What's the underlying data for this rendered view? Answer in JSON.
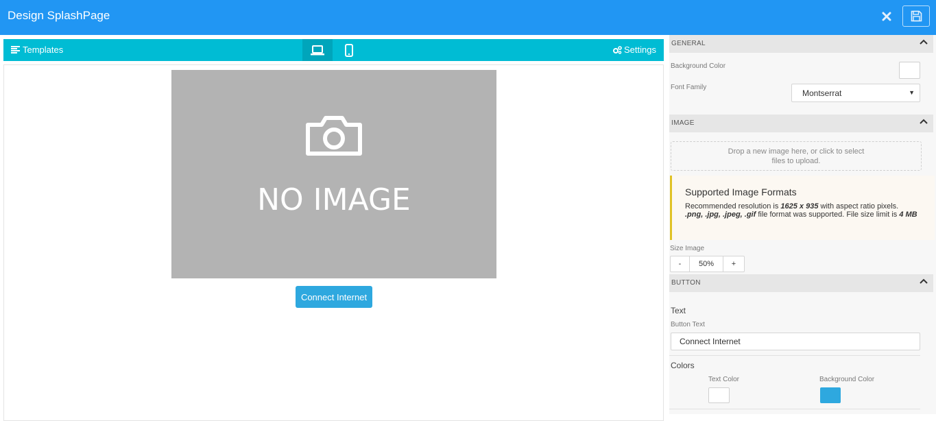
{
  "app": {
    "title": "Design SplashPage"
  },
  "toolbar": {
    "templates_label": "Templates",
    "settings_label": "Settings"
  },
  "canvas": {
    "placeholder_text": "NO IMAGE",
    "connect_button_label": "Connect Internet"
  },
  "panel": {
    "general": {
      "heading": "GENERAL",
      "background_color_label": "Background Color",
      "background_color": "#ffffff",
      "font_family_label": "Font Family",
      "font_family_value": "Montserrat"
    },
    "image": {
      "heading": "IMAGE",
      "dropzone_line1": "Drop a new image here, or click to select",
      "dropzone_line2": "files to upload.",
      "info_title": "Supported Image Formats",
      "info_prefix": "Recommended resolution is ",
      "info_resolution": "1625 x 935",
      "info_mid": " with aspect ratio pixels. ",
      "info_formats": ".png, .jpg, .jpeg, .gif",
      "info_mid2": " file format was supported. File size limit is ",
      "info_limit": "4 MB",
      "size_label": "Size Image",
      "size_minus": "-",
      "size_value": "50%",
      "size_plus": "+"
    },
    "button": {
      "heading": "BUTTON",
      "text_section": "Text",
      "button_text_label": "Button Text",
      "button_text_value": "Connect Internet",
      "colors_section": "Colors",
      "text_color_label": "Text Color",
      "text_color": "#ffffff",
      "bg_color_label": "Background Color",
      "bg_color": "#2ea8df"
    }
  },
  "icons": {
    "close": "close-icon",
    "save": "floppy-disk-icon",
    "templates": "list-icon",
    "desktop": "laptop-icon",
    "mobile": "mobile-phone-icon",
    "settings": "gears-icon",
    "camera": "camera-icon",
    "chevron": "chevron-up-icon"
  },
  "colors": {
    "topbar": "#2196f3",
    "toolbar": "#00bcd4",
    "placeholder_bg": "#b3b3b3",
    "accent_button": "#2ea8df",
    "info_border": "#e0c225"
  }
}
